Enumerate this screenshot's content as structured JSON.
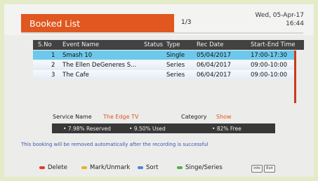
{
  "header": {
    "title": "Booked List",
    "page_indicator": "1/3",
    "date": "Wed, 05-Apr-17",
    "time": "16:44"
  },
  "table": {
    "columns": [
      "S.No",
      "Event Name",
      "Status",
      "Type",
      "Rec Date",
      "Start-End Time"
    ],
    "rows": [
      {
        "sno": "1",
        "event": "Smash 10",
        "status": "",
        "type": "Single",
        "rec_date": "05/04/2017",
        "time": "17:00-17:30",
        "selected": true
      },
      {
        "sno": "2",
        "event": "The Ellen DeGeneres S...",
        "status": "",
        "type": "Series",
        "rec_date": "06/04/2017",
        "time": "09:00-10:00",
        "selected": false
      },
      {
        "sno": "3",
        "event": "The Cafe",
        "status": "",
        "type": "Series",
        "rec_date": "06/04/2017",
        "time": "09:00-10:00",
        "selected": false
      }
    ]
  },
  "details": {
    "service_label": "Service Name",
    "service_value": "The Edge TV",
    "category_label": "Category",
    "category_value": "Show"
  },
  "stats": {
    "reserved": "7.98% Reserved",
    "used": "9.50% Used",
    "free": "82% Free"
  },
  "message": "This booking will be removed automatically after the recording is successful",
  "footer": {
    "delete_label": "Delete",
    "mark_label": "Mark/Unmark",
    "sort_label": "Sort",
    "single_series_label": "Singe/Series",
    "info_key": "Info",
    "exit_key": "Exit",
    "colors": {
      "red": "#e0392f",
      "yellow": "#e8b02a",
      "blue": "#4a86d8",
      "green": "#4cb050"
    }
  }
}
